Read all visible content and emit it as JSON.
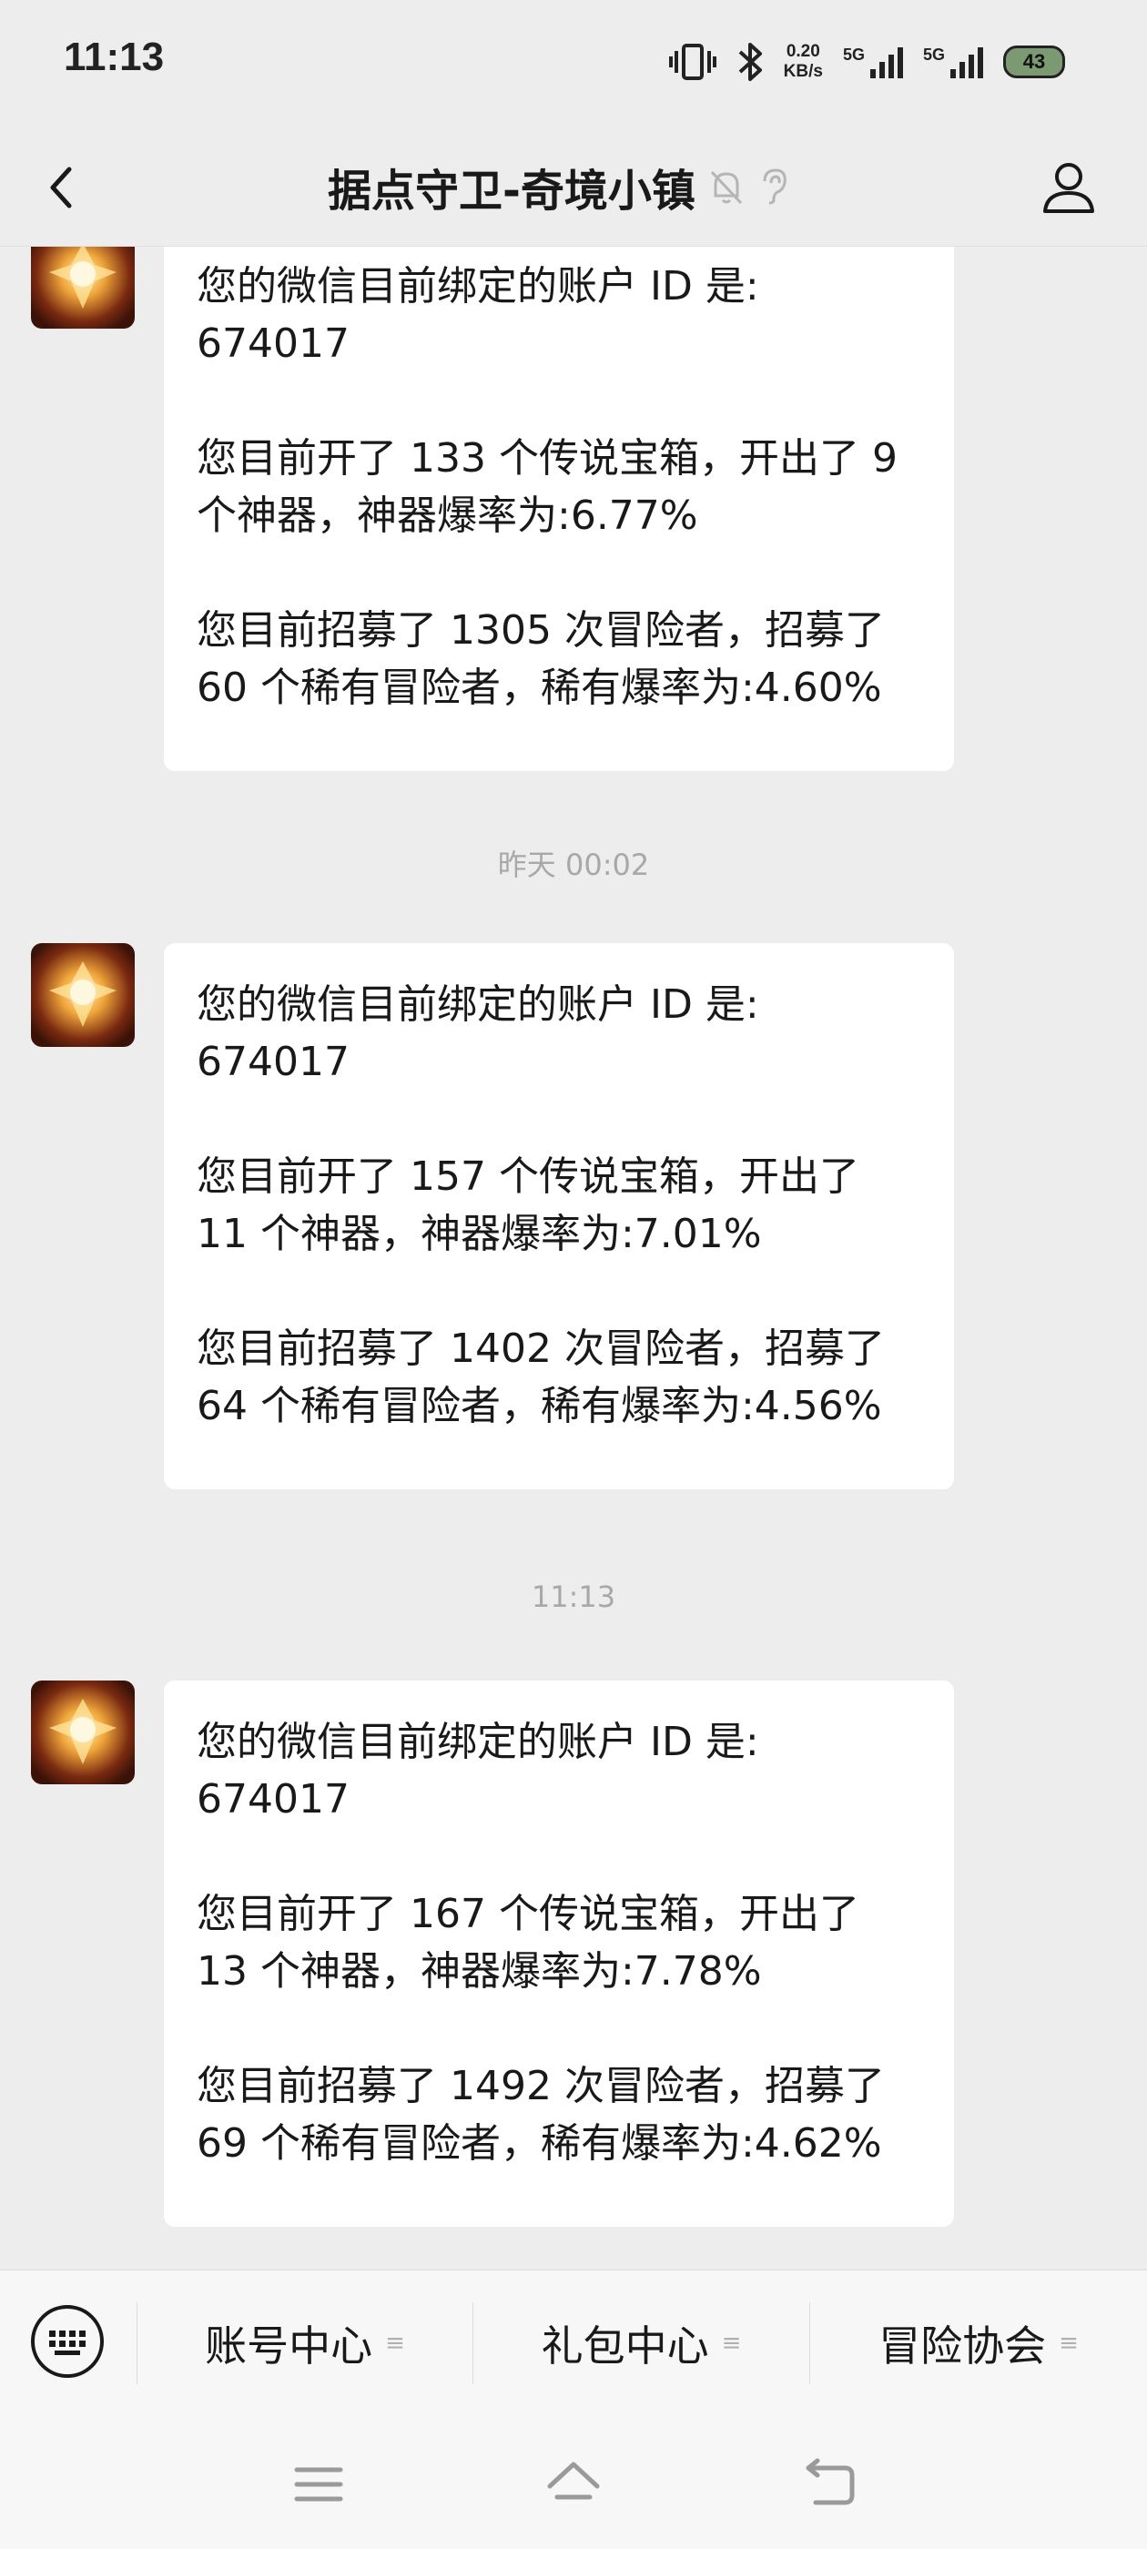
{
  "status_bar": {
    "time": "11:13",
    "net_speed_value": "0.20",
    "net_speed_unit": "KB/s",
    "sim1_label": "5G",
    "sim2_label": "5G",
    "battery": "43"
  },
  "header": {
    "title": "据点守卫-奇境小镇"
  },
  "messages": [
    {
      "lines": [
        "您的微信目前绑定的账户 ID 是: 674017",
        "您目前开了 133 个传说宝箱，开出了 9 个神器，神器爆率为:6.77%",
        "您目前招募了 1305 次冒险者，招募了 60 个稀有冒险者，稀有爆率为:4.60%"
      ]
    },
    {
      "lines": [
        "您的微信目前绑定的账户 ID 是: 674017",
        "您目前开了 157 个传说宝箱，开出了 11 个神器，神器爆率为:7.01%",
        "您目前招募了 1402 次冒险者，招募了 64 个稀有冒险者，稀有爆率为:4.56%"
      ]
    },
    {
      "lines": [
        "您的微信目前绑定的账户 ID 是: 674017",
        "您目前开了 167 个传说宝箱，开出了 13 个神器，神器爆率为:7.78%",
        "您目前招募了 1492 次冒险者，招募了 69 个稀有冒险者，稀有爆率为:4.62%"
      ]
    }
  ],
  "timestamps": [
    "昨天 00:02",
    "11:13"
  ],
  "menu": {
    "items": [
      {
        "label": "账号中心"
      },
      {
        "label": "礼包中心"
      },
      {
        "label": "冒险协会"
      }
    ]
  },
  "icons": {
    "back": "chevron-left-icon",
    "mute": "bell-off-icon",
    "earpiece": "ear-icon",
    "profile": "user-icon",
    "keyboard": "keyboard-icon",
    "sys_menu": "menu-icon",
    "sys_home": "home-icon",
    "sys_back": "back-arrow-icon"
  },
  "colors": {
    "background": "#ededed",
    "bubble": "#ffffff",
    "timestamp": "#a8a8a8"
  }
}
